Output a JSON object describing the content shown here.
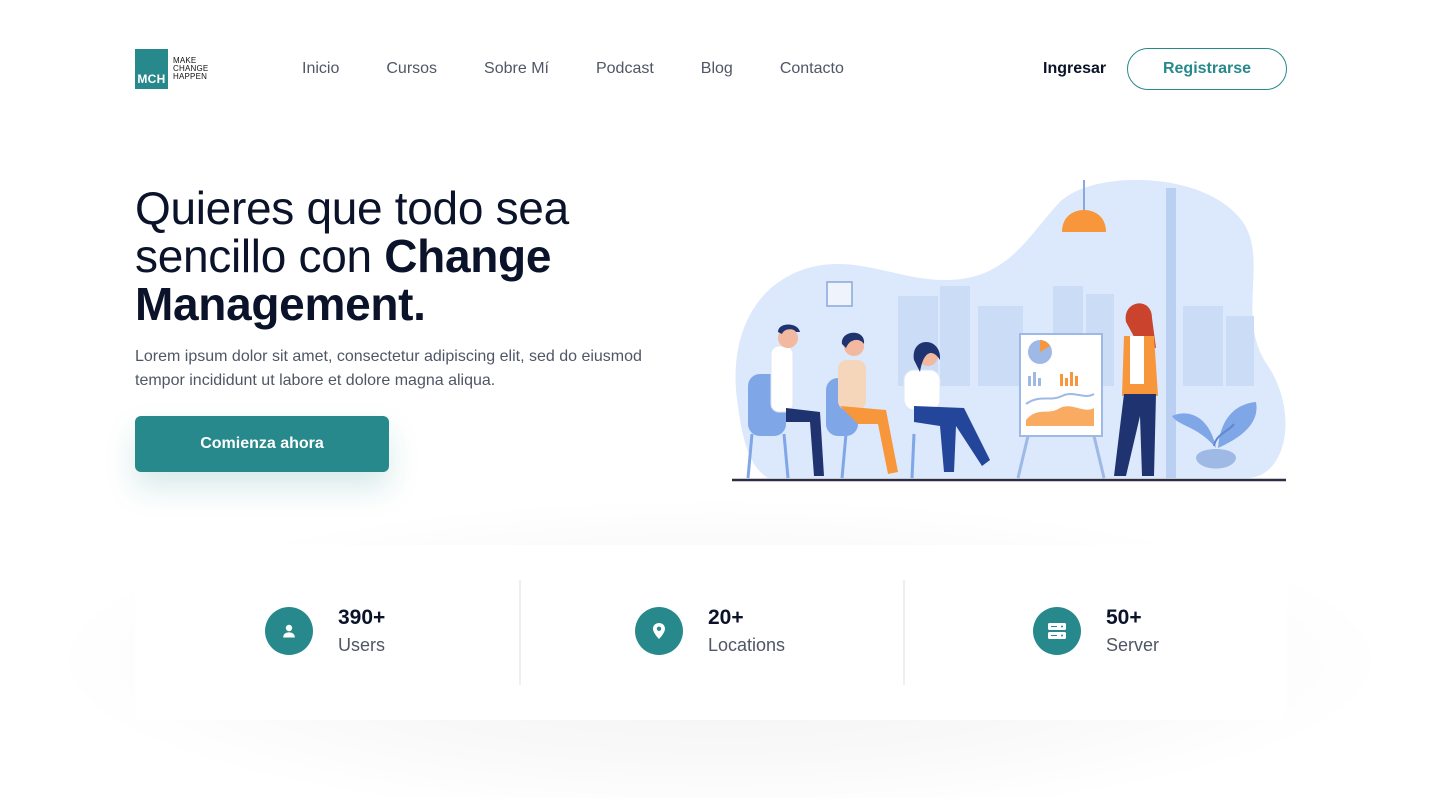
{
  "logo": {
    "abbr": "MCH",
    "line1": "MAKE",
    "line2": "CHANGE",
    "line3": "HAPPEN"
  },
  "nav": {
    "items": [
      "Inicio",
      "Cursos",
      "Sobre Mí",
      "Podcast",
      "Blog",
      "Contacto"
    ]
  },
  "header": {
    "login_label": "Ingresar",
    "signup_label": "Registrarse"
  },
  "hero": {
    "title_part1": "Quieres que todo sea sencillo con ",
    "title_bold": "Change Management.",
    "description": "Lorem ipsum dolor sit amet, consectetur adipiscing elit, sed do eiusmod tempor incididunt ut labore et dolore magna aliqua.",
    "cta_label": "Comienza ahora"
  },
  "stats": [
    {
      "value": "390+",
      "label": "Users",
      "icon": "user-icon"
    },
    {
      "value": "20+",
      "label": "Locations",
      "icon": "location-pin-icon"
    },
    {
      "value": "50+",
      "label": "Server",
      "icon": "server-icon"
    }
  ],
  "colors": {
    "primary": "#27898c",
    "heading": "#0b132a",
    "body_text": "#4f5665",
    "illustration_blue": "#dce8fb",
    "illustration_orange": "#f7963a"
  }
}
